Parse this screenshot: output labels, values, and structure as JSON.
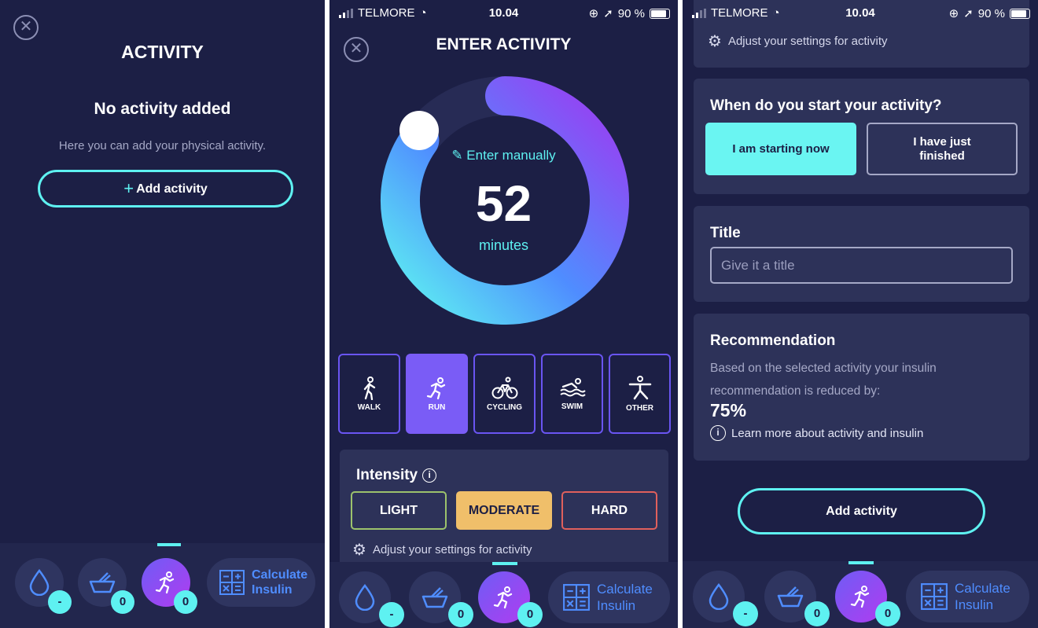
{
  "screen1": {
    "header_title": "ACTIVITY",
    "empty_title": "No activity added",
    "empty_text": "Here you can add your physical activity.",
    "add_button": "Add activity"
  },
  "screen2": {
    "status": {
      "carrier": "TELMORE",
      "time": "10.04",
      "battery": "90 %"
    },
    "header_title": "ENTER ACTIVITY",
    "enter_manually": "Enter manually",
    "duration_value": "52",
    "duration_unit": "minutes",
    "activities": [
      {
        "label": "WALK",
        "icon": "walk-icon",
        "selected": false
      },
      {
        "label": "RUN",
        "icon": "run-icon",
        "selected": true
      },
      {
        "label": "CYCLING",
        "icon": "cycling-icon",
        "selected": false
      },
      {
        "label": "SWIM",
        "icon": "swim-icon",
        "selected": false
      },
      {
        "label": "OTHER",
        "icon": "other-icon",
        "selected": false
      }
    ],
    "intensity_title": "Intensity",
    "intensity_options": [
      "LIGHT",
      "MODERATE",
      "HARD"
    ],
    "intensity_selected": "MODERATE",
    "adjust_settings": "Adjust your settings for activity"
  },
  "screen3": {
    "status": {
      "carrier": "TELMORE",
      "time": "10.04",
      "battery": "90 %"
    },
    "adjust_settings": "Adjust your settings for activity",
    "start_question": "When do you start your activity?",
    "start_options": [
      "I am starting now",
      "I have just finished"
    ],
    "start_selected": "I am starting now",
    "title_label": "Title",
    "title_placeholder": "Give it a title",
    "recommendation_title": "Recommendation",
    "recommendation_text": "Based on the selected activity your insulin recommendation is reduced by:",
    "recommendation_value": "75%",
    "learn_more": "Learn more about activity and insulin",
    "add_button": "Add activity"
  },
  "nav": {
    "glucose_badge": "-",
    "carbs_badge": "0",
    "activity_badge": "0",
    "calculate_label_1": "Calculate",
    "calculate_label_2": "Insulin"
  },
  "colors": {
    "background": "#1c1f45",
    "card": "#2d3259",
    "accent_cyan": "#5ef1f1",
    "accent_purple": "#7a5cf6",
    "light": "#9cc26c",
    "moderate": "#f0bf6a",
    "hard": "#e0605c",
    "calc_blue": "#4f8dff"
  }
}
